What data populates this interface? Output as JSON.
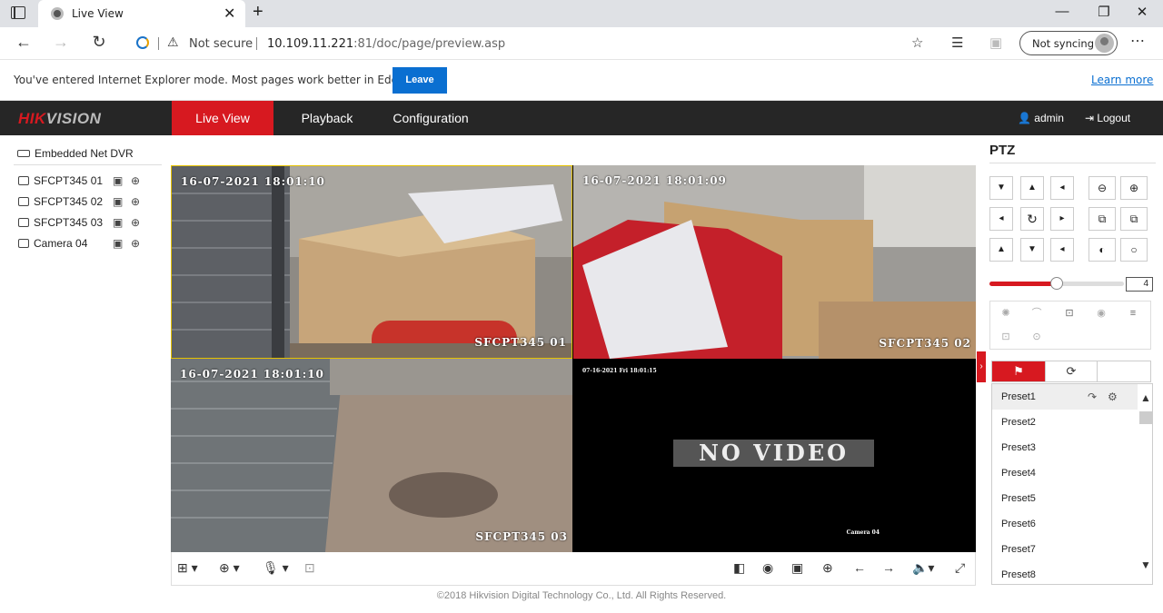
{
  "browser": {
    "tab_title": "Live View",
    "tab_close": "✕",
    "new_tab": "+",
    "win_min": "—",
    "win_max": "❐",
    "win_close": "✕",
    "nav_back": "←",
    "nav_forward": "→",
    "nav_refresh": "↻",
    "warning_glyph": "⚠",
    "not_secure": "Not secure",
    "url_host": "10.109.11.221",
    "url_rest": ":81/doc/page/preview.asp",
    "sync_label": "Not syncing",
    "more": "⋯"
  },
  "ie_banner": {
    "message": "You've entered Internet Explorer mode. Most pages work better in Edge.",
    "leave_label": "Leave",
    "learn_more": "Learn more"
  },
  "hik": {
    "logo_a": "HIK",
    "logo_b": "VISION",
    "nav": {
      "live": "Live View",
      "playback": "Playback",
      "config": "Configuration"
    },
    "user": "admin",
    "logout": "Logout",
    "brand_color": "#d71920"
  },
  "tree": {
    "device": "Embedded Net DVR",
    "cameras": [
      {
        "label": "SFCPT345 01"
      },
      {
        "label": "SFCPT345 02"
      },
      {
        "label": "SFCPT345 03"
      },
      {
        "label": "Camera 04"
      }
    ]
  },
  "video": {
    "cells": [
      {
        "time": "16-07-2021 18:01:10",
        "name": "SFCPT345  01"
      },
      {
        "time": "16-07-2021 18:01:09",
        "name": "SFCPT345  02"
      },
      {
        "time": "16-07-2021 18:01:10",
        "name": "SFCPT345  03"
      },
      {
        "time": "07-16-2021 Fri 18:01:15",
        "name": "Camera 04",
        "status": "NO VIDEO"
      }
    ]
  },
  "footer": "©2018 Hikvision Digital Technology Co., Ltd. All Rights Reserved.",
  "ptz": {
    "title": "PTZ",
    "speed": "4",
    "speed_fraction": 0.5,
    "presets": [
      "Preset1",
      "Preset2",
      "Preset3",
      "Preset4",
      "Preset5",
      "Preset6",
      "Preset7",
      "Preset8"
    ]
  }
}
